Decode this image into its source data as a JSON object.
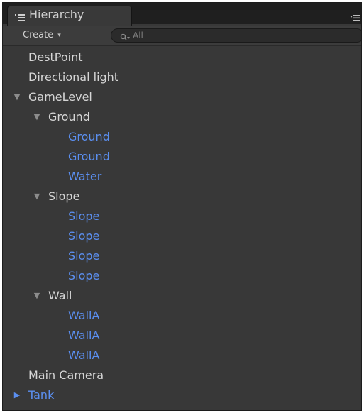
{
  "window": {
    "tab_title": "Hierarchy",
    "tab_icon": "hierarchy-list-icon",
    "menu_icon": "panel-options-icon"
  },
  "toolbar": {
    "create_label": "Create",
    "create_caret": "▾",
    "search_icon": "search-icon",
    "search_placeholder": "All"
  },
  "colors": {
    "panel_bg": "#383838",
    "text": "#d6d6d6",
    "prefab_text": "#5b8ff0",
    "arrow": "#8c8c8c"
  },
  "tree": [
    {
      "label": "DestPoint",
      "depth": 0,
      "arrow": "",
      "prefab": false
    },
    {
      "label": "Directional light",
      "depth": 0,
      "arrow": "",
      "prefab": false
    },
    {
      "label": "GameLevel",
      "depth": 0,
      "arrow": "▼",
      "prefab": false
    },
    {
      "label": "Ground",
      "depth": 1,
      "arrow": "▼",
      "prefab": false
    },
    {
      "label": "Ground",
      "depth": 2,
      "arrow": "",
      "prefab": true
    },
    {
      "label": "Ground",
      "depth": 2,
      "arrow": "",
      "prefab": true
    },
    {
      "label": "Water",
      "depth": 2,
      "arrow": "",
      "prefab": true
    },
    {
      "label": "Slope",
      "depth": 1,
      "arrow": "▼",
      "prefab": false
    },
    {
      "label": "Slope",
      "depth": 2,
      "arrow": "",
      "prefab": true
    },
    {
      "label": "Slope",
      "depth": 2,
      "arrow": "",
      "prefab": true
    },
    {
      "label": "Slope",
      "depth": 2,
      "arrow": "",
      "prefab": true
    },
    {
      "label": "Slope",
      "depth": 2,
      "arrow": "",
      "prefab": true
    },
    {
      "label": "Wall",
      "depth": 1,
      "arrow": "▼",
      "prefab": false
    },
    {
      "label": "WallA",
      "depth": 2,
      "arrow": "",
      "prefab": true
    },
    {
      "label": "WallA",
      "depth": 2,
      "arrow": "",
      "prefab": true
    },
    {
      "label": "WallA",
      "depth": 2,
      "arrow": "",
      "prefab": true
    },
    {
      "label": "Main Camera",
      "depth": 0,
      "arrow": "",
      "prefab": false
    },
    {
      "label": "Tank",
      "depth": 0,
      "arrow": "▶",
      "prefab": true
    }
  ]
}
